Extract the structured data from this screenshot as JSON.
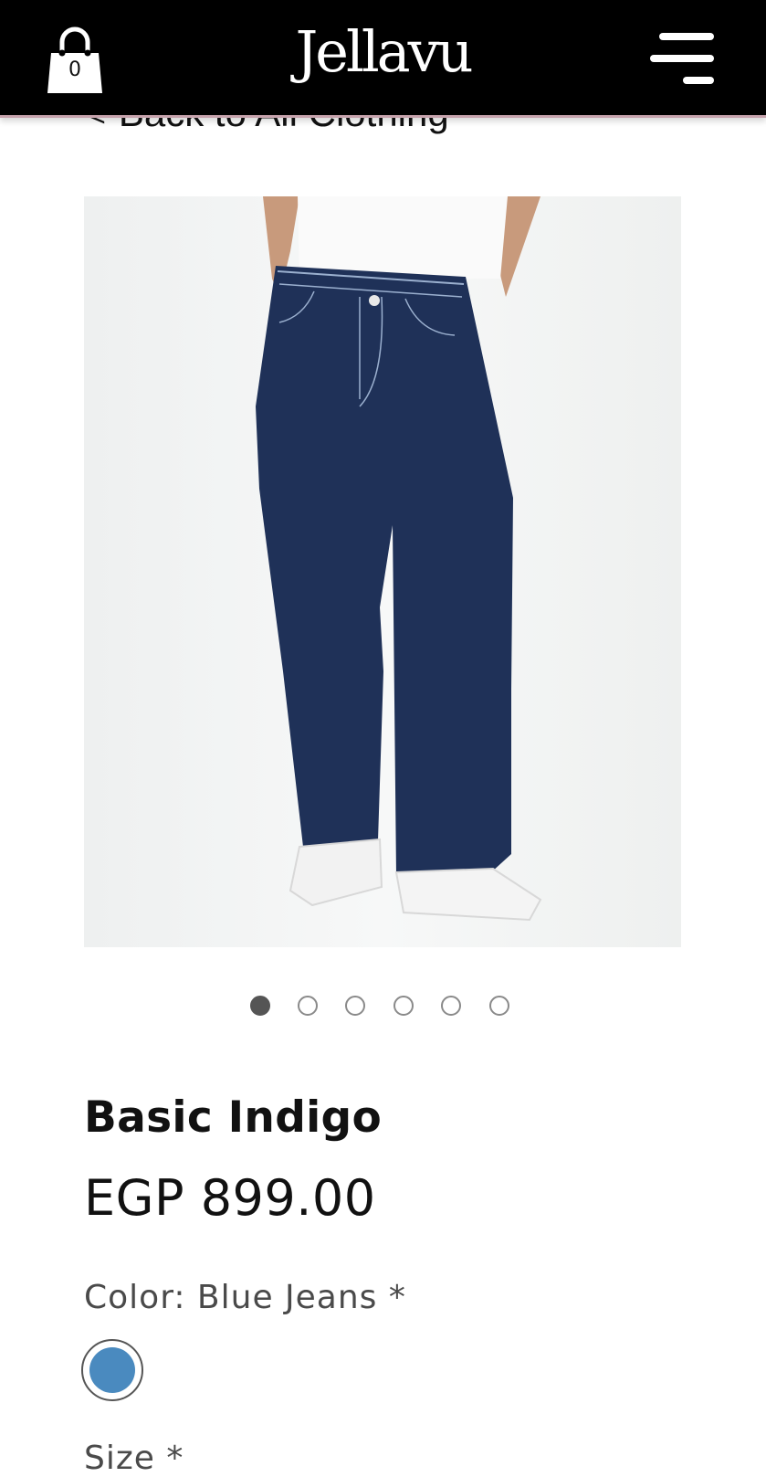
{
  "header": {
    "brand": "Jellavu",
    "cart_count": "0",
    "cart_icon": "shopping-bag-icon",
    "menu_icon": "hamburger-menu-icon"
  },
  "back_link": {
    "label": "Back to All Clothing",
    "icon": "chevron-left-icon"
  },
  "gallery": {
    "image_count": 6,
    "active_index": 0
  },
  "product": {
    "title": "Basic Indigo",
    "price": "EGP 899.00",
    "color_label": "Color: Blue Jeans *",
    "selected_color": "#4a8abf",
    "size_label": "Size *"
  },
  "colors": {
    "header_bg": "#000000",
    "header_border": "#c7a3ad",
    "denim": "#1f3158"
  }
}
